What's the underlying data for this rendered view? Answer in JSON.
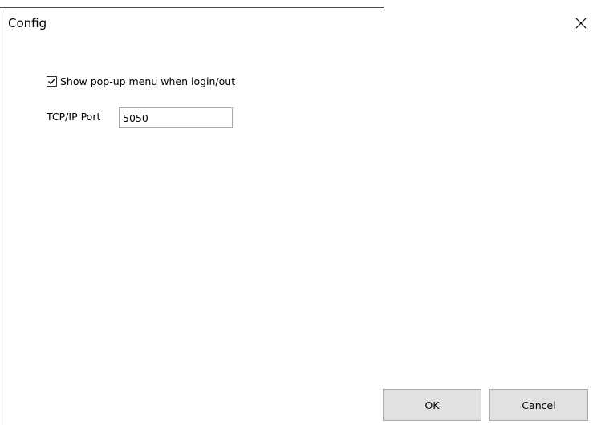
{
  "window": {
    "title": "Config",
    "close_icon": "close-icon"
  },
  "settings": {
    "show_popup": {
      "label": "Show pop-up menu when login/out",
      "checked": true
    },
    "tcp_port": {
      "label": "TCP/IP Port",
      "value": "5050"
    }
  },
  "buttons": {
    "ok_label": "OK",
    "cancel_label": "Cancel"
  }
}
